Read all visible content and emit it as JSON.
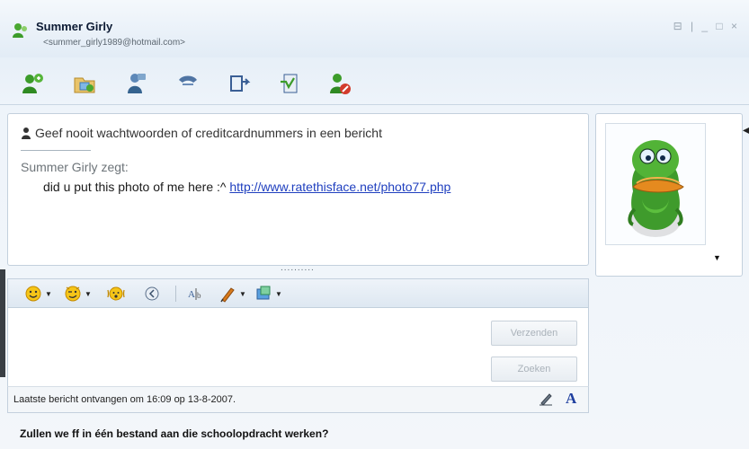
{
  "window": {
    "title": "Summer Girly",
    "email": "<summer_girly1989@hotmail.com>",
    "controls": "⊟ | _ □ ×"
  },
  "toolbar": {
    "icons": [
      "invite-contact-icon",
      "send-files-icon",
      "video-call-icon",
      "call-icon",
      "share-folders-icon",
      "activities-icon",
      "block-contact-icon"
    ]
  },
  "conversation": {
    "warning": "Geef nooit wachtwoorden of creditcardnummers in een bericht",
    "sender_line": "Summer Girly zegt:",
    "message_text": "did u put this photo of me here :^ ",
    "message_link": "http://www.ratethisface.net/photo77.php"
  },
  "splitter": "..........",
  "display_picture": {
    "arrow": "▼",
    "collapse": "◀"
  },
  "compose_toolbar": {
    "icons": [
      "emoticon-icon",
      "wink-icon",
      "nudge-icon",
      "voice-clip-icon",
      "font-icon",
      "pen-icon",
      "background-icon"
    ]
  },
  "compose": {
    "send_label": "Verzenden",
    "search_label": "Zoeken"
  },
  "status": {
    "text": "Laatste bericht ontvangen om 16:09 op 13-8-2007.",
    "font_button": "A"
  },
  "footer": {
    "text": "Zullen we ff in één bestand aan die schoolopdracht werken?"
  },
  "colors": {
    "link": "#1f3fbf",
    "accent": "#1f3f9f",
    "contact_icon_green": "#3c9c2a"
  }
}
